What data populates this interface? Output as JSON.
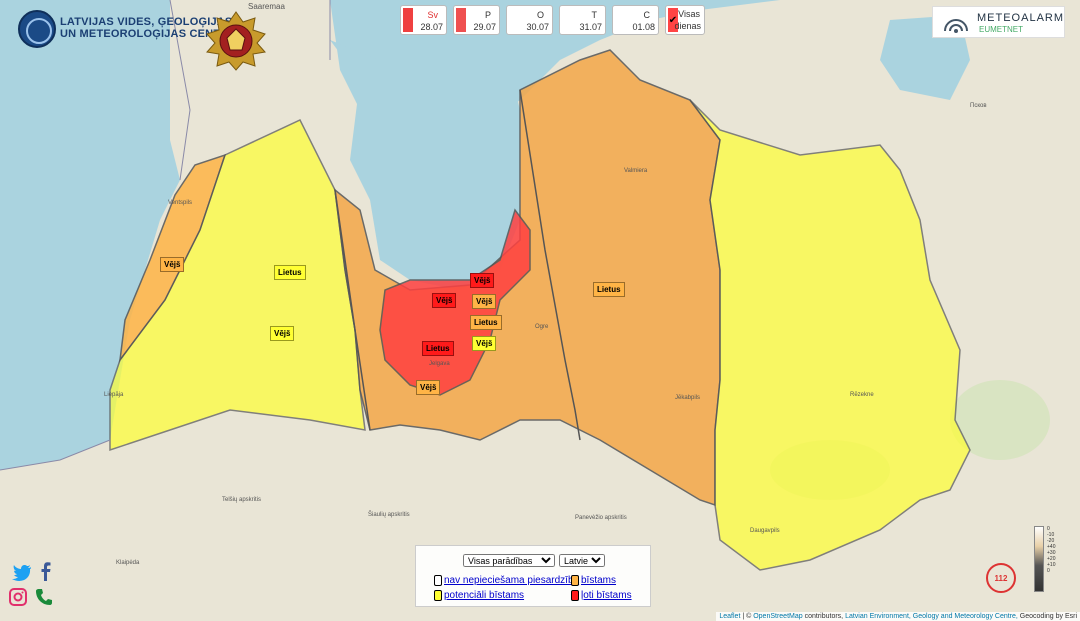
{
  "header": {
    "org_name_line1": "LATVIJAS VIDES, ĢEOLOĢIJAS",
    "org_name_line2": "UN METEOROLOĢIJAS CENTRS"
  },
  "days": [
    {
      "weekday": "Sv",
      "date": "28.07",
      "color": "#ef4040",
      "selected": true
    },
    {
      "weekday": "P",
      "date": "29.07",
      "color": "#ef5050",
      "selected": false
    },
    {
      "weekday": "O",
      "date": "30.07",
      "color": "",
      "selected": false
    },
    {
      "weekday": "T",
      "date": "31.07",
      "color": "",
      "selected": false
    },
    {
      "weekday": "C",
      "date": "01.08",
      "color": "",
      "selected": false
    }
  ],
  "all_days": {
    "line1": "Visas",
    "line2": "dienas"
  },
  "meteoalarm": {
    "title": "METEOALARM",
    "subtitle": "EUMETNET"
  },
  "warning_labels": [
    {
      "text": "Vējš",
      "level": "orange"
    },
    {
      "text": "Lietus",
      "level": "yellow"
    },
    {
      "text": "Vējš",
      "level": "yellow"
    },
    {
      "text": "Vējš",
      "level": "red"
    },
    {
      "text": "Vējš",
      "level": "red"
    },
    {
      "text": "Vējš",
      "level": "orange"
    },
    {
      "text": "Lietus",
      "level": "orange"
    },
    {
      "text": "Lietus",
      "level": "red"
    },
    {
      "text": "Vējš",
      "level": "yellow"
    },
    {
      "text": "Vējš",
      "level": "orange"
    },
    {
      "text": "Lietus",
      "level": "orange"
    }
  ],
  "places": [
    "Saaremaa",
    "Ventspils",
    "Liepāja",
    "Valmiera",
    "Ogre",
    "Jelgava",
    "Jēkabpils",
    "Rēzekne",
    "Daugavpils",
    "Klaipėda",
    "Псков",
    "Telšių apskritis",
    "Šiaulių apskritis",
    "Panevėžio apskritis"
  ],
  "legend": {
    "filter_selected": "Visas parādības",
    "language_selected": "Latviešu",
    "items": [
      {
        "label": "nav nepieciešama piesardzība",
        "color": "#ffffff"
      },
      {
        "label": "bīstams",
        "color": "#ffb446"
      },
      {
        "label": "potenciāli bīstams",
        "color": "#ffff33"
      },
      {
        "label": "ļoti bīstams",
        "color": "#ff1a1a"
      }
    ]
  },
  "emergency": {
    "number": "112"
  },
  "scale_labels": [
    "0",
    "-10",
    "-20",
    "+40",
    "+30",
    "+20",
    "+10",
    "0"
  ],
  "attribution": {
    "leaflet": "Leaflet",
    "osm": "OpenStreetMap",
    "contributors": "contributors,",
    "lvgmc": "Latvian Environment, Geology and Meteorology Centre,",
    "geocoding": "Geocoding by Esri"
  },
  "colors": {
    "yellow": "#ffff33",
    "orange": "#ffb446",
    "red": "#ff1a1a",
    "sea": "#aad3df",
    "land": "#e8e4d8"
  }
}
